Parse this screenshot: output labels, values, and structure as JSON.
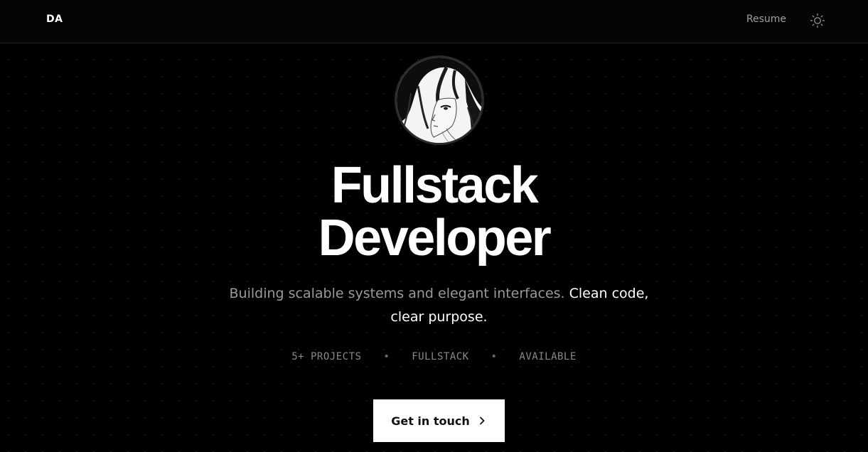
{
  "nav": {
    "logo": "DA",
    "resume_label": "Resume",
    "theme_icon": "sun-icon"
  },
  "hero": {
    "avatar_icon": "manga-portrait-avatar",
    "title_line1": "Fullstack",
    "title_line2": "Developer",
    "subtitle_muted": "Building scalable systems and elegant interfaces.",
    "subtitle_strong": "Clean code, clear purpose.",
    "stats": [
      "5+ PROJECTS",
      "FULLSTACK",
      "AVAILABLE"
    ],
    "stats_separator": "•",
    "cta_label": "Get in touch",
    "cta_icon": "chevron-right-icon"
  },
  "colors": {
    "background": "#000000",
    "text_primary": "#ffffff",
    "text_muted": "#9a9a9a",
    "cta_background": "#ffffff",
    "cta_text": "#111111"
  }
}
